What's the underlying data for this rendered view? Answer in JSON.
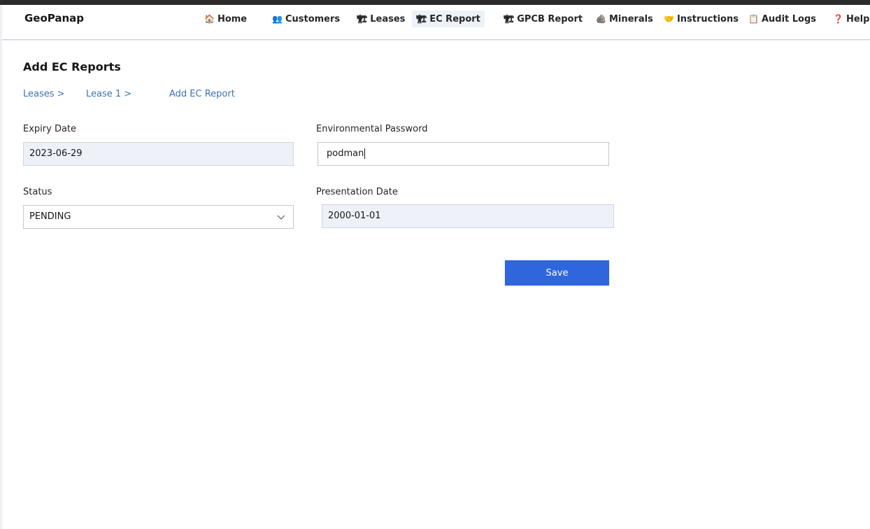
{
  "app": {
    "brand": "GeoPanap"
  },
  "nav": [
    {
      "icon": "house-icon",
      "glyph": "🏠",
      "label": "Home"
    },
    {
      "icon": "people-icon",
      "glyph": "👥",
      "label": "Customers"
    },
    {
      "icon": "oil-rig-icon",
      "glyph": "🏗",
      "label": "Leases"
    },
    {
      "icon": "oil-rig-icon",
      "glyph": "🏗",
      "label": "EC Report"
    },
    {
      "icon": "oil-rig-icon",
      "glyph": "🏗",
      "label": "GPCB Report"
    },
    {
      "icon": "rock-icon",
      "glyph": "🪨",
      "label": "Minerals"
    },
    {
      "icon": "handshake-icon",
      "glyph": "🤝",
      "label": "Instructions"
    },
    {
      "icon": "clipboard-icon",
      "glyph": "📋",
      "label": "Audit Logs"
    },
    {
      "icon": "question-icon",
      "glyph": "❓",
      "label": "Help"
    }
  ],
  "page": {
    "title": "Add EC Reports"
  },
  "breadcrumb": [
    "Leases >",
    "Lease 1 >",
    "Add EC Report"
  ],
  "form": {
    "expiry_date": {
      "label": "Expiry Date",
      "value": "2023-06-29"
    },
    "env_password": {
      "label": "Environmental Password",
      "value": "podman"
    },
    "status": {
      "label": "Status",
      "value": "PENDING"
    },
    "presentation_date": {
      "label": "Presentation Date",
      "value": "2000-01-01"
    },
    "save_label": "Save"
  }
}
